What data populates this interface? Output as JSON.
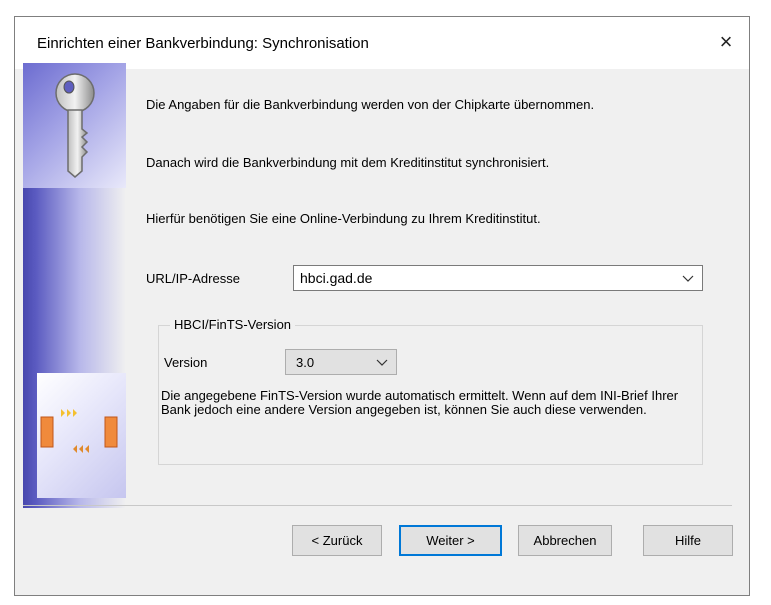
{
  "window": {
    "title": "Einrichten einer Bankverbindung: Synchronisation",
    "close_icon": "×"
  },
  "info_lines": [
    "Die Angaben für die Bankverbindung werden von der Chipkarte übernommen.",
    "Danach wird die Bankverbindung mit dem Kreditinstitut synchronisiert.",
    "Hierfür benötigen Sie eine Online-Verbindung zu Ihrem Kreditinstitut."
  ],
  "url": {
    "label": "URL/IP-Adresse",
    "value": "hbci.gad.de"
  },
  "hbci_group": {
    "title": "HBCI/FinTS-Version",
    "version_label": "Version",
    "version_value": "3.0",
    "info_text": "Die angegebene FinTS-Version wurde automatisch ermittelt. Wenn auf dem INI-Brief Ihrer Bank jedoch eine andere Version angegeben ist, können Sie auch diese verwenden."
  },
  "buttons": {
    "back": "< Zurück",
    "next": "Weiter >",
    "cancel": "Abbrechen",
    "help": "Hilfe"
  },
  "icons": {
    "key": "key-icon",
    "transfer": "data-transfer-icon",
    "chevron": "chevron-down-icon"
  },
  "colors": {
    "sidebar_dark": "#4848ae",
    "sidebar_light": "#b7b7ea",
    "default_button_border": "#0078d7",
    "transfer_orange": "#f08a3c"
  }
}
